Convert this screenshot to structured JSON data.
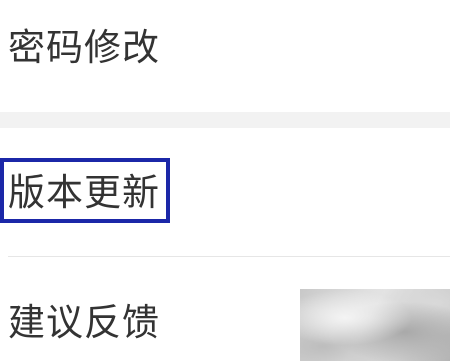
{
  "settings": {
    "items": [
      {
        "label": "密码修改"
      },
      {
        "label": "版本更新"
      },
      {
        "label": "建议反馈"
      }
    ]
  },
  "colors": {
    "highlight_border": "#1b27a8",
    "section_gap": "#f2f2f2",
    "text": "#333333"
  }
}
